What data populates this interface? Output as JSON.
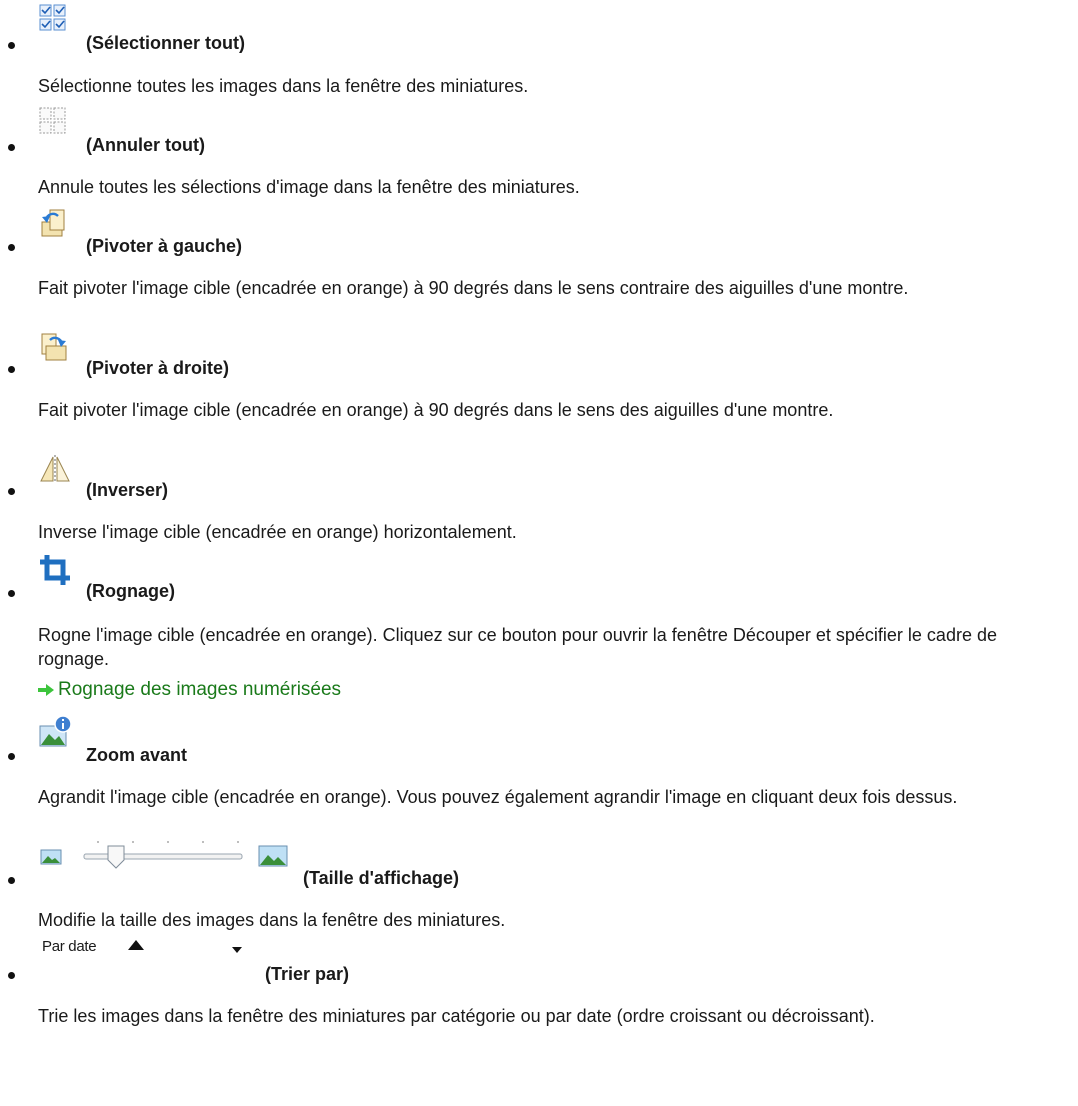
{
  "items": [
    {
      "title": "(Sélectionner tout)",
      "icon": "select-all-icon",
      "desc": "Sélectionne toutes les images dans la fenêtre des miniatures."
    },
    {
      "title": "(Annuler tout)",
      "icon": "cancel-all-icon",
      "desc": "Annule toutes les sélections d'image dans la fenêtre des miniatures."
    },
    {
      "title": "(Pivoter à gauche)",
      "icon": "rotate-left-icon",
      "desc": "Fait pivoter l'image cible (encadrée en orange) à 90 degrés dans le sens contraire des aiguilles d'une montre."
    },
    {
      "title": "(Pivoter à droite)",
      "icon": "rotate-right-icon",
      "desc": "Fait pivoter l'image cible (encadrée en orange) à 90 degrés dans le sens des aiguilles d'une montre."
    },
    {
      "title": "(Inverser)",
      "icon": "invert-icon",
      "desc": "Inverse l'image cible (encadrée en orange) horizontalement."
    },
    {
      "title": "(Rognage)",
      "icon": "crop-icon",
      "desc": "Rogne l'image cible (encadrée en orange). Cliquez sur ce bouton pour ouvrir la fenêtre Découper et spécifier le cadre de rognage.",
      "link": "Rognage des images numérisées"
    },
    {
      "title": "Zoom avant",
      "icon": "zoom-in-icon",
      "desc": "Agrandit l'image cible (encadrée en orange). Vous pouvez également agrandir l'image en cliquant deux fois dessus."
    },
    {
      "title": "(Taille d'affichage)",
      "icon": "display-size-slider",
      "desc": "Modifie la taille des images dans la fenêtre des miniatures.",
      "slider_level": 0.25
    },
    {
      "title": "(Trier par)",
      "icon": "sort-dropdown",
      "desc": "Trie les images dans la fenêtre des miniatures par catégorie ou par date (ordre croissant ou décroissant).",
      "dropdown_value": "Par date"
    }
  ],
  "colors": {
    "link": "#1a7a1a",
    "arrow": "#3cc43c",
    "icon_blue": "#2a7bd4"
  }
}
